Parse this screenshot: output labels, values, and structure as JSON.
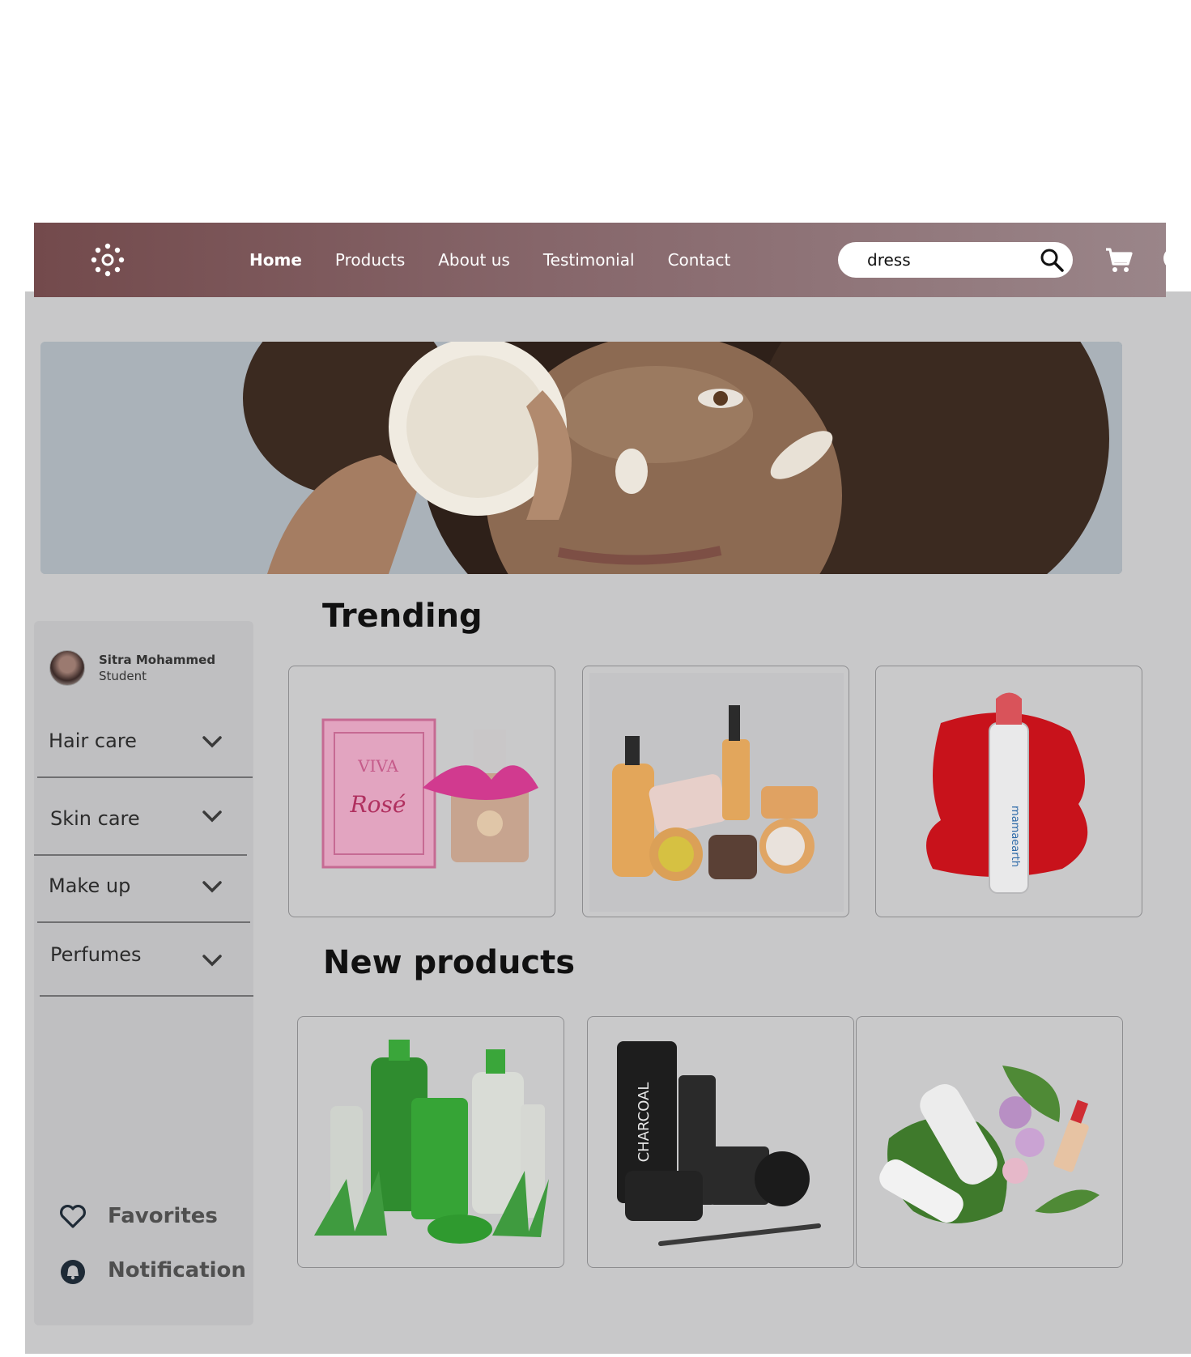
{
  "header": {
    "logo_icon": "canvas-logo-icon",
    "nav": [
      {
        "label": "Home",
        "active": true
      },
      {
        "label": "Products",
        "active": false
      },
      {
        "label": "About us",
        "active": false
      },
      {
        "label": "Testimonial",
        "active": false
      },
      {
        "label": "Contact",
        "active": false
      }
    ],
    "search": {
      "value": "dress",
      "icon": "search-icon"
    },
    "cart_icon": "cart-icon"
  },
  "hero": {
    "image": "woman-holding-face-cream-jar"
  },
  "sidebar": {
    "profile": {
      "name": "Sitra Mohammed",
      "role": "Student"
    },
    "categories": [
      {
        "label": "Hair care"
      },
      {
        "label": "Skin care"
      },
      {
        "label": "Make up"
      },
      {
        "label": "Perfumes"
      }
    ],
    "links": [
      {
        "label": "Favorites",
        "icon": "heart-icon"
      },
      {
        "label": "Notification",
        "icon": "bell-icon"
      }
    ]
  },
  "sections": {
    "trending": {
      "title": "Trending",
      "products": [
        "perfume-viva-la-juicy-rose",
        "skincare-set-orange-jars",
        "red-lipstick-mamaearth"
      ]
    },
    "new_products": {
      "title": "New products",
      "products": [
        "aloe-vera-green-products",
        "charcoal-shampoo-set",
        "white-bottles-leaves"
      ]
    }
  },
  "colors": {
    "navbar_start": "#734a4c",
    "navbar_end": "#9a8589",
    "page_overlay": "#c8c8c9",
    "sidebar": "#bfbfc1"
  }
}
